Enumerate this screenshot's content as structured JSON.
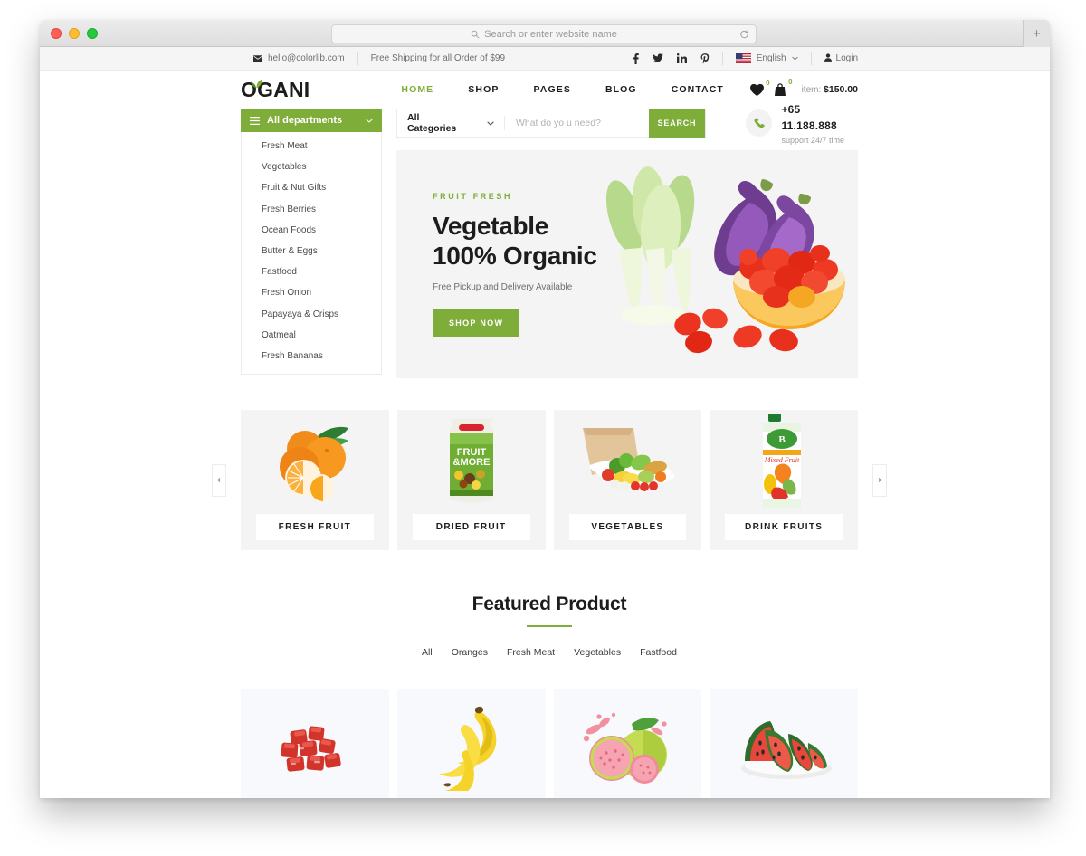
{
  "browser": {
    "url_placeholder": "Search or enter website name",
    "newtab_label": "+",
    "reload_icon": "reload-icon",
    "search_icon": "search-icon"
  },
  "topbar": {
    "email": "hello@colorlib.com",
    "shipping": "Free Shipping for all Order of $99",
    "socials": [
      {
        "name": "facebook-icon",
        "glyph": "f"
      },
      {
        "name": "twitter-icon",
        "glyph": "t"
      },
      {
        "name": "linkedin-icon",
        "glyph": "in"
      },
      {
        "name": "pinterest-icon",
        "glyph": "p"
      }
    ],
    "language": "English",
    "login": "Login"
  },
  "header": {
    "logo": "OGANI",
    "nav": [
      {
        "label": "HOME",
        "active": true
      },
      {
        "label": "SHOP",
        "active": false
      },
      {
        "label": "PAGES",
        "active": false
      },
      {
        "label": "BLOG",
        "active": false
      },
      {
        "label": "CONTACT",
        "active": false
      }
    ],
    "wishlist_count": "0",
    "cart_count": "0",
    "cart_label": "item:",
    "cart_total": "$150.00"
  },
  "departments": {
    "title": "All departments",
    "items": [
      "Fresh Meat",
      "Vegetables",
      "Fruit & Nut Gifts",
      "Fresh Berries",
      "Ocean Foods",
      "Butter & Eggs",
      "Fastfood",
      "Fresh Onion",
      "Papayaya & Crisps",
      "Oatmeal",
      "Fresh Bananas"
    ]
  },
  "search": {
    "category": "All Categories",
    "placeholder": "What do yo u need?",
    "value": "",
    "button": "SEARCH"
  },
  "phone": {
    "number": "+65 11.188.888",
    "support": "support 24/7 time"
  },
  "hero": {
    "kicker": "FRUIT FRESH",
    "title_line1": "Vegetable",
    "title_line2": "100% Organic",
    "subtitle": "Free Pickup and Delivery Available",
    "button": "SHOP NOW"
  },
  "categories": {
    "prev_icon": "chevron-left-icon",
    "next_icon": "chevron-right-icon",
    "items": [
      {
        "label": "FRESH FRUIT",
        "image": "oranges"
      },
      {
        "label": "DRIED FRUIT",
        "image": "fruit-and-more-pack"
      },
      {
        "label": "VEGETABLES",
        "image": "grocery-bag"
      },
      {
        "label": "DRINK FRUITS",
        "image": "juice-carton"
      }
    ]
  },
  "featured": {
    "title": "Featured Product",
    "filters": [
      {
        "label": "All",
        "active": true
      },
      {
        "label": "Oranges",
        "active": false
      },
      {
        "label": "Fresh Meat",
        "active": false
      },
      {
        "label": "Vegetables",
        "active": false
      },
      {
        "label": "Fastfood",
        "active": false
      }
    ],
    "products": [
      {
        "image": "beef-cubes"
      },
      {
        "image": "bananas"
      },
      {
        "image": "guava"
      },
      {
        "image": "watermelon-slices"
      }
    ]
  },
  "colors": {
    "brand_green": "#7fad39",
    "text_dark": "#1c1c1c",
    "muted": "#9a9a9a",
    "panel_gray": "#f4f4f4",
    "product_bg": "#f7f9fc"
  }
}
